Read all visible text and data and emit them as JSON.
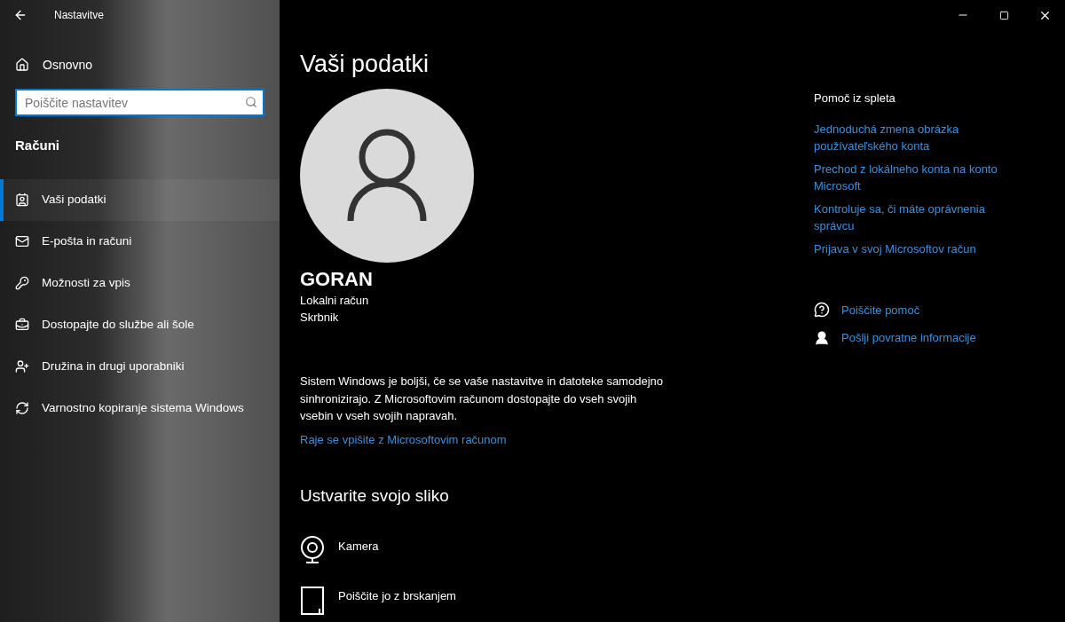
{
  "window": {
    "title": "Nastavitve"
  },
  "sidebar": {
    "home": "Osnovno",
    "search": {
      "placeholder": "Poiščite nastavitev"
    },
    "section": "Računi",
    "items": [
      {
        "label": "Vaši podatki",
        "selected": true
      },
      {
        "label": "E-pošta in računi",
        "selected": false
      },
      {
        "label": "Možnosti za vpis",
        "selected": false
      },
      {
        "label": "Dostopajte do službe ali šole",
        "selected": false
      },
      {
        "label": "Družina in drugi uporabniki",
        "selected": false
      },
      {
        "label": "Varnostno kopiranje sistema Windows",
        "selected": false
      }
    ]
  },
  "main": {
    "title": "Vaši podatki",
    "user": {
      "name": "GORAN",
      "account_type": "Lokalni račun",
      "role": "Skrbnik"
    },
    "description": "Sistem Windows je boljši, če se vaše nastavitve in datoteke samodejno sinhronizirajo. Z Microsoftovim računom dostopajte do vseh svojih vsebin v vseh svojih napravah.",
    "link": "Raje se vpišite z Microsoftovim računom",
    "picture_section": {
      "title": "Ustvarite svojo sliko",
      "options": [
        {
          "kind": "camera",
          "label": "Kamera"
        },
        {
          "kind": "browse",
          "label": "Poiščite jo z brskanjem"
        }
      ]
    }
  },
  "help": {
    "title": "Pomoč iz spleta",
    "links": [
      "Jednoduchá zmena obrázka používateľského konta",
      "Prechod z lokálneho konta na konto Microsoft",
      "Kontroluje sa, či máte oprávnenia správcu",
      "Prijava v svoj Microsoftov račun"
    ],
    "actions": [
      {
        "kind": "help",
        "label": "Poiščite pomoč"
      },
      {
        "kind": "feedback",
        "label": "Pošlji povratne informacije"
      }
    ]
  }
}
